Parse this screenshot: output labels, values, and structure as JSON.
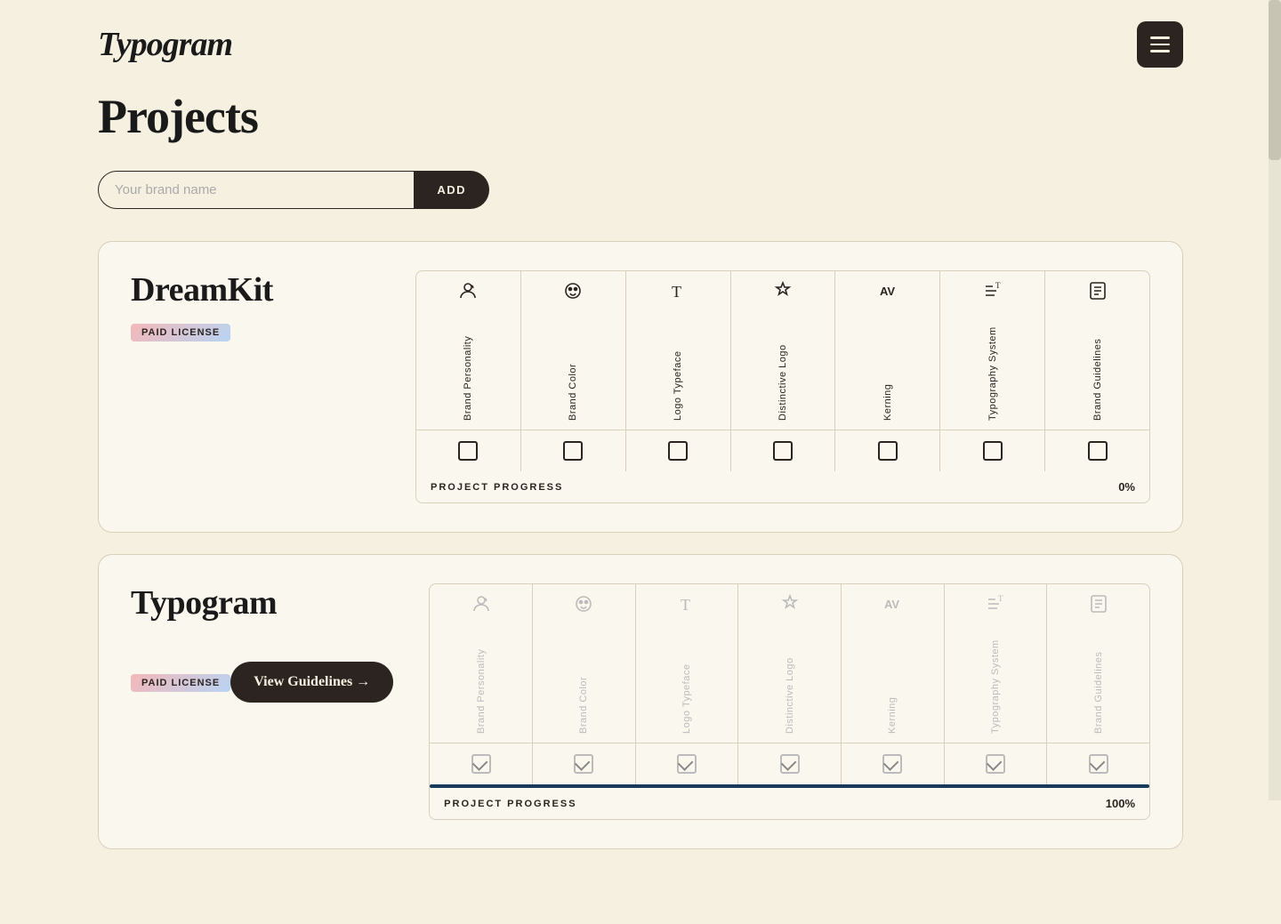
{
  "header": {
    "logo": "Typogram",
    "menu_label": "menu"
  },
  "page": {
    "title": "Projects"
  },
  "add_form": {
    "placeholder": "Your brand name",
    "button_label": "ADD"
  },
  "projects": [
    {
      "id": "dreamkit",
      "name": "DreamKit",
      "license": "PAID LICENSE",
      "progress_percent": "0%",
      "progress_bar_width": 0,
      "completed": false,
      "show_view_btn": false,
      "columns": [
        {
          "icon": "👤",
          "label": "Brand Personality",
          "checked": false
        },
        {
          "icon": "🎨",
          "label": "Brand Color",
          "checked": false
        },
        {
          "icon": "T",
          "label": "Logo Typeface",
          "checked": false
        },
        {
          "icon": "🏷",
          "label": "Distinctive Logo",
          "checked": false
        },
        {
          "icon": "AV",
          "label": "Kerning",
          "checked": false
        },
        {
          "icon": "≡T",
          "label": "Typography System",
          "checked": false
        },
        {
          "icon": "📋",
          "label": "Brand Guidelines",
          "checked": false
        }
      ]
    },
    {
      "id": "typogram",
      "name": "Typogram",
      "license": "PAID LICENSE",
      "progress_percent": "100%",
      "progress_bar_width": 100,
      "completed": true,
      "show_view_btn": true,
      "view_btn_label": "View Guidelines →",
      "columns": [
        {
          "icon": "👤",
          "label": "Brand Personality",
          "checked": true
        },
        {
          "icon": "🎨",
          "label": "Brand Color",
          "checked": true
        },
        {
          "icon": "T",
          "label": "Logo Typeface",
          "checked": true
        },
        {
          "icon": "🏷",
          "label": "Distinctive Logo",
          "checked": true
        },
        {
          "icon": "AV",
          "label": "Kerning",
          "checked": true
        },
        {
          "icon": "≡T",
          "label": "Typography System",
          "checked": true
        },
        {
          "icon": "📋",
          "label": "Brand Guidelines",
          "checked": true
        }
      ]
    }
  ],
  "progress_label": "PROJECT PROGRESS"
}
